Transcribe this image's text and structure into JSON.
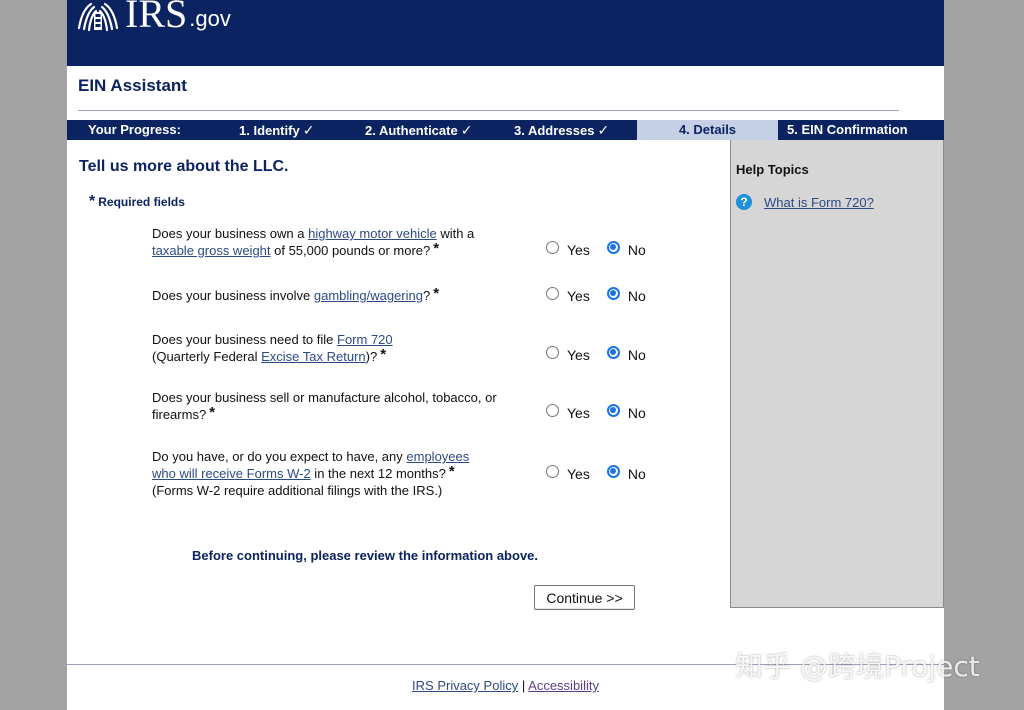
{
  "header": {
    "logo_main": "IRS",
    "logo_suffix": ".gov"
  },
  "app_title": "EIN Assistant",
  "progress": {
    "label": "Your Progress:",
    "steps": [
      {
        "label": "1. Identify",
        "done": true
      },
      {
        "label": "2. Authenticate",
        "done": true
      },
      {
        "label": "3. Addresses",
        "done": true
      },
      {
        "label": "4. Details",
        "current": true
      },
      {
        "label": "5. EIN Confirmation"
      }
    ],
    "check_glyph": "✓"
  },
  "main": {
    "section_title": "Tell us more about the LLC.",
    "required_star": "*",
    "required_label": "Required fields",
    "questions": [
      {
        "pre": "Does your business own a ",
        "link1": "highway motor vehicle",
        "mid": " with a",
        "link2": "taxable gross weight",
        "post": " of 55,000 pounds or more?",
        "answer": "No"
      },
      {
        "pre": "Does your business involve ",
        "link1": "gambling/wagering",
        "post": "?",
        "answer": "No"
      },
      {
        "pre": "Does your business need to file ",
        "link1": "Form 720",
        "mid": "(Quarterly Federal ",
        "link2": "Excise Tax Return",
        "post": ")?",
        "answer": "No"
      },
      {
        "text_line1": "Does your business sell or manufacture alcohol, tobacco, or",
        "text_line2": "firearms?",
        "answer": "No"
      },
      {
        "pre": "Do you have, or do you expect to have, any ",
        "link1": "employees",
        "link2": "who will receive Forms W-2",
        "post": " in the next 12 months?",
        "note": "(Forms W-2 require additional filings with the IRS.)",
        "answer": "No"
      }
    ],
    "yes_label": "Yes",
    "no_label": "No",
    "review_note": "Before continuing, please review the information above.",
    "continue_label": "Continue >>"
  },
  "sidebar": {
    "title": "Help Topics",
    "link": "What is Form 720?"
  },
  "footer": {
    "privacy": "IRS Privacy Policy",
    "sep": "|",
    "accessibility": "Accessibility"
  },
  "watermark": "知乎 @跨境Project",
  "colors": {
    "navy": "#0b2360",
    "current_step": "#c5cfe6",
    "sidebar": "#d6d6d6",
    "link": "#2c4a86",
    "radio_checked": "#1a73e8"
  }
}
